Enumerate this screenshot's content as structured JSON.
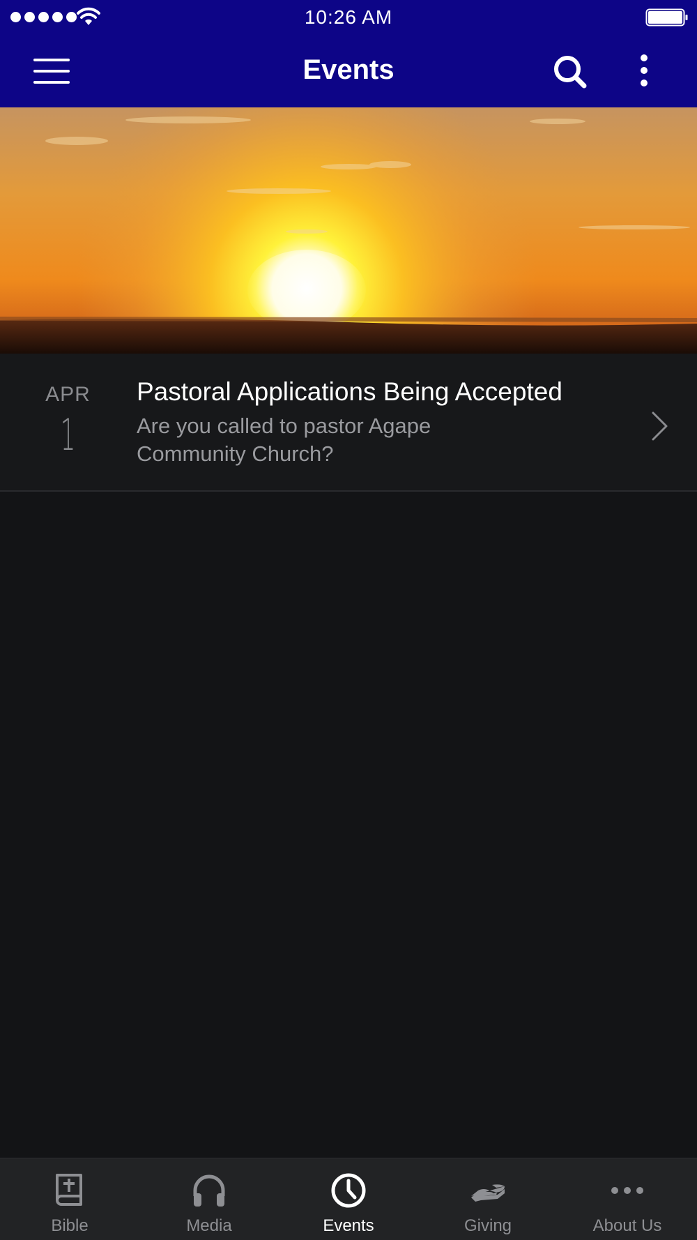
{
  "status_bar": {
    "time": "10:26 AM",
    "icons": [
      "signal-dots",
      "wifi-icon",
      "battery-icon"
    ]
  },
  "nav": {
    "title": "Events",
    "icons": [
      "menu-icon",
      "search-icon",
      "more-vertical-icon"
    ],
    "bar_color": "#0d0587"
  },
  "hero": {
    "image": "sunset-over-horizon"
  },
  "events": [
    {
      "month": "APR",
      "day": "1",
      "title": "Pastoral Applications Being Accepted",
      "description": "Are you called to pastor Agape Community Church?"
    }
  ],
  "tabs": [
    {
      "label": "Bible",
      "icon": "bible-icon",
      "active": false
    },
    {
      "label": "Media",
      "icon": "headphones-icon",
      "active": false
    },
    {
      "label": "Events",
      "icon": "clock-icon",
      "active": true
    },
    {
      "label": "Giving",
      "icon": "giving-hand-icon",
      "active": false
    },
    {
      "label": "About Us",
      "icon": "more-horizontal-icon",
      "active": false
    }
  ],
  "colors": {
    "background": "#131416",
    "tab_bar": "#222325",
    "active_tab": "#ffffff",
    "inactive_tab": "#8e8f93"
  }
}
